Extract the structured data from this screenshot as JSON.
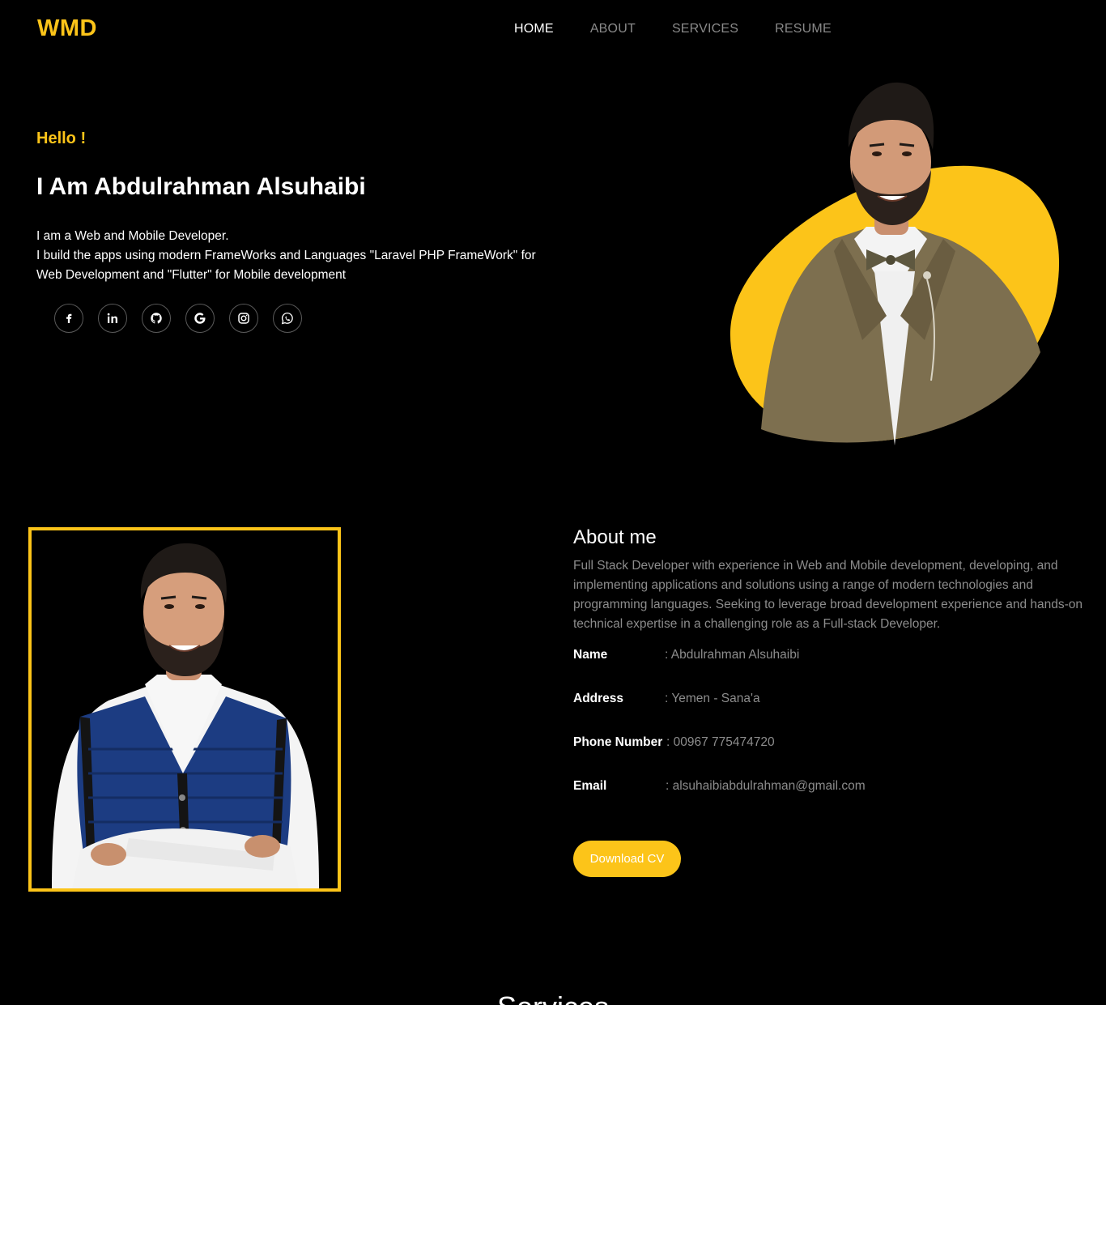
{
  "nav": {
    "logo": "WMD",
    "items": [
      {
        "label": "HOME",
        "active": true
      },
      {
        "label": "ABOUT",
        "active": false
      },
      {
        "label": "SERVICES",
        "active": false
      },
      {
        "label": "RESUME",
        "active": false
      }
    ]
  },
  "hero": {
    "greeting": "Hello !",
    "name": "I Am Abdulrahman Alsuhaibi",
    "description_line1": "I am a Web and Mobile Developer.",
    "description_line2": "I build the apps using modern FrameWorks and Languages \"Laravel PHP FrameWork\" for Web Development and \"Flutter\" for Mobile development",
    "socials": [
      "facebook-icon",
      "linkedin-icon",
      "github-icon",
      "google-icon",
      "instagram-icon",
      "whatsapp-icon"
    ]
  },
  "about": {
    "title": "About me",
    "text": "Full Stack Developer with experience in Web and Mobile development, developing, and implementing applications and solutions using a range of modern technologies and programming languages. Seeking to leverage broad development experience and hands-on technical expertise in a challenging role as a Full-stack Developer.",
    "info": {
      "name_label": "Name",
      "name_value": ": Abdulrahman Alsuhaibi",
      "address_label": "Address",
      "address_value": ": Yemen - Sana'a",
      "phone_label": "Phone Number",
      "phone_value": ": 00967 775474720",
      "email_label": "Email",
      "email_value": ": alsuhaibiabdulrahman@gmail.com"
    },
    "download_label": "Download CV"
  },
  "services": {
    "title": "Services"
  },
  "colors": {
    "accent": "#fcc419",
    "background": "#000000",
    "muted_text": "#8c8c8c"
  }
}
